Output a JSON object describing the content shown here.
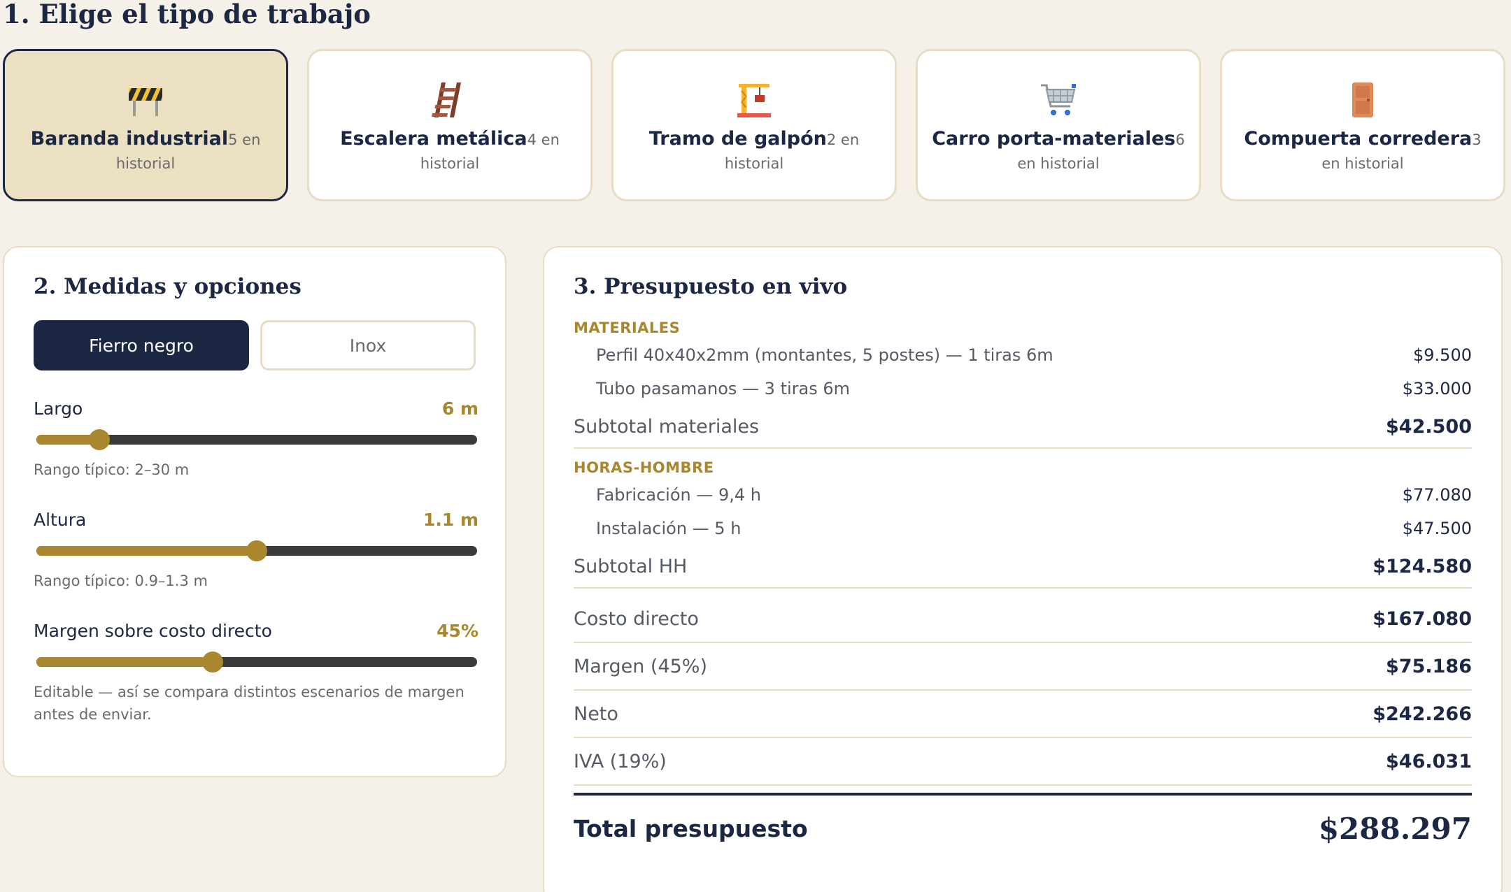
{
  "section1": {
    "title": "1. Elige el tipo de trabajo"
  },
  "jobs": [
    {
      "name": "Baranda industrial",
      "history": "5 en historial",
      "icon": "barrier-icon",
      "selected": true
    },
    {
      "name": "Escalera metálica",
      "history": "4 en historial",
      "icon": "ladder-icon",
      "selected": false
    },
    {
      "name": "Tramo de galpón",
      "history": "2 en historial",
      "icon": "crane-icon",
      "selected": false
    },
    {
      "name": "Carro porta-materiales",
      "history": "6 en historial",
      "icon": "cart-icon",
      "selected": false
    },
    {
      "name": "Compuerta corredera",
      "history": "3 en historial",
      "icon": "door-icon",
      "selected": false
    }
  ],
  "options": {
    "title": "2. Medidas y opciones",
    "material_toggle": {
      "active": "Fierro negro",
      "inactive": "Inox"
    },
    "sliders": {
      "largo": {
        "label": "Largo",
        "value": "6 m",
        "fraction": 0.143,
        "note": "Rango típico: 2–30 m"
      },
      "altura": {
        "label": "Altura",
        "value": "1.1 m",
        "fraction": 0.5,
        "note": "Rango típico: 0.9–1.3 m"
      },
      "margen": {
        "label": "Margen sobre costo directo",
        "value": "45%",
        "fraction": 0.4,
        "note": "Editable — así se compara distintos escenarios de margen antes de enviar."
      }
    }
  },
  "budget": {
    "title": "3. Presupuesto en vivo",
    "materiales": {
      "heading": "MATERIALES",
      "items": [
        {
          "label": "Perfil 40x40x2mm (montantes, 5 postes) — 1 tiras 6m",
          "value": "$9.500"
        },
        {
          "label": "Tubo pasamanos — 3 tiras 6m",
          "value": "$33.000"
        }
      ],
      "subtotal_label": "Subtotal materiales",
      "subtotal_value": "$42.500"
    },
    "horas": {
      "heading": "HORAS-HOMBRE",
      "items": [
        {
          "label": "Fabricación — 9,4 h",
          "value": "$77.080"
        },
        {
          "label": "Instalación — 5 h",
          "value": "$47.500"
        }
      ],
      "subtotal_label": "Subtotal HH",
      "subtotal_value": "$124.580"
    },
    "costo_directo": {
      "label": "Costo directo",
      "value": "$167.080"
    },
    "margen": {
      "label": "Margen (45%)",
      "value": "$75.186"
    },
    "neto": {
      "label": "Neto",
      "value": "$242.266"
    },
    "iva": {
      "label": "IVA (19%)",
      "value": "$46.031"
    },
    "total": {
      "label": "Total presupuesto",
      "value": "$288.297"
    }
  },
  "colors": {
    "accent": "#a8872e",
    "navy": "#1c2744",
    "background": "#f6f1e8",
    "border": "#e8dcc4"
  }
}
